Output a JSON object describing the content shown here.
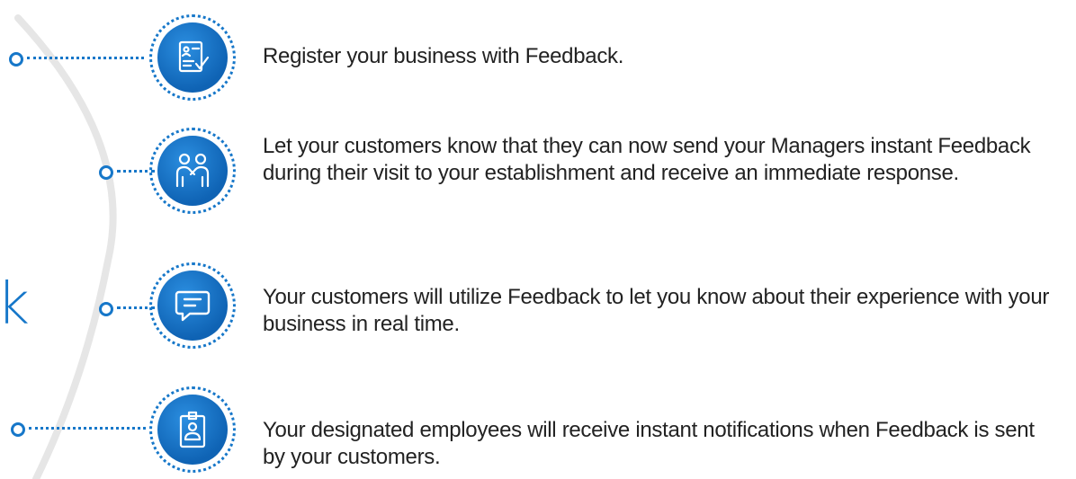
{
  "steps": [
    {
      "text": "Register your business with Feedback.",
      "icon": "document-check-icon"
    },
    {
      "text": "Let your customers know that they can now send your Managers instant Feedback during their visit to your establishment and receive an immediate response.",
      "icon": "handshake-icon"
    },
    {
      "text": "Your customers will utilize Feedback to let you know about their experience with your business in real time.",
      "icon": "chat-bubble-icon"
    },
    {
      "text": "Your designated employees will receive instant notifications when Feedback is sent by your customers.",
      "icon": "id-badge-icon"
    }
  ],
  "partial_glyphs": [
    "k"
  ],
  "colors": {
    "accent": "#1677c9",
    "text": "#222222",
    "arc": "#e3e3e3"
  }
}
